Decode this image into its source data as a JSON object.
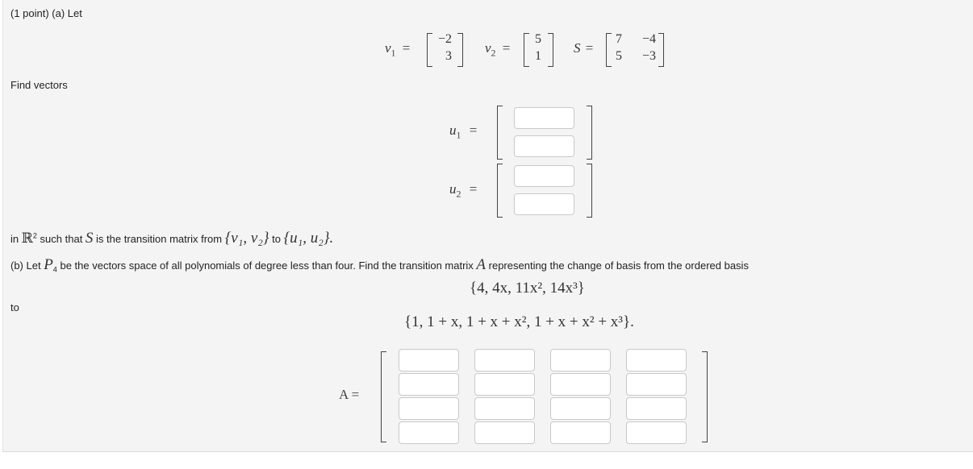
{
  "part_a": {
    "intro": "(1 point) (a) Let",
    "v1": {
      "label": "v",
      "sub": "1",
      "entries": [
        "−2",
        "3"
      ]
    },
    "v2": {
      "label": "v",
      "sub": "2",
      "entries": [
        "5",
        "1"
      ]
    },
    "S": {
      "label": "S",
      "entries": [
        [
          "7",
          "−4"
        ],
        [
          "5",
          "−3"
        ]
      ]
    },
    "find_text": "Find vectors",
    "u1": {
      "label": "u",
      "sub": "1",
      "inputs": [
        "",
        ""
      ]
    },
    "u2": {
      "label": "u",
      "sub": "2",
      "inputs": [
        "",
        ""
      ]
    },
    "closing": {
      "in": "in ",
      "R": "ℝ",
      "R_sup": "2",
      "mid": " such that ",
      "S": "S",
      "mid2": " is the transition matrix from ",
      "set1": "{v₁, v₂}",
      "to": " to ",
      "set2": "{u₁, u₂}."
    }
  },
  "part_b": {
    "prefix": "(b) Let ",
    "P": "P",
    "P_sub": "4",
    "text": " be the vectors space of all polynomials of degree less than four. Find the transition matrix ",
    "A": "A",
    "text2": " representing the change of basis from the ordered basis",
    "basis_from": "{4, 4x, 11x², 14x³}",
    "to_label": "to",
    "basis_to": "{1, 1 + x, 1 + x + x², 1 + x + x² + x³}.",
    "A_label": "A =",
    "matrix_inputs": [
      [
        "",
        "",
        "",
        ""
      ],
      [
        "",
        "",
        "",
        ""
      ],
      [
        "",
        "",
        "",
        ""
      ],
      [
        "",
        "",
        "",
        ""
      ]
    ]
  },
  "symbols": {
    "equals": "="
  }
}
